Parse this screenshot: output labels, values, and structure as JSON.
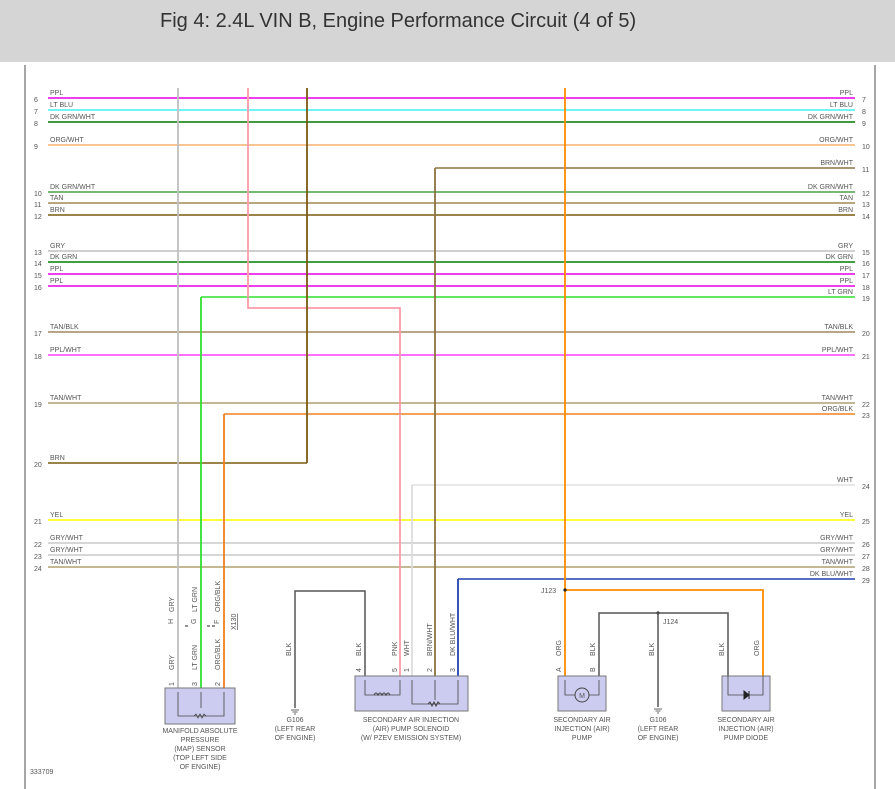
{
  "title": "Fig 4: 2.4L VIN B, Engine Performance Circuit (4 of 5)",
  "figure_id": "333709",
  "wires": [
    {
      "left_num": "6",
      "label": "PPL",
      "right_num": "7",
      "color": "#e600e6"
    },
    {
      "left_num": "7",
      "label": "LT BLU",
      "right_num": "8",
      "color": "#40f0f0"
    },
    {
      "left_num": "8",
      "label": "DK GRN/WHT",
      "right_num": "9",
      "color": "#007a00"
    },
    {
      "left_num": "9",
      "label": "ORG/WHT",
      "right_num": "10",
      "color": "#f5b070"
    },
    {
      "left_num": "",
      "label": "BRN/WHT",
      "right_num": "11",
      "color": "#8b7340"
    },
    {
      "left_num": "10",
      "label": "DK GRN/WHT",
      "right_num": "12",
      "color": "#4aa04a"
    },
    {
      "left_num": "11",
      "label": "TAN",
      "right_num": "13",
      "color": "#a08850"
    },
    {
      "left_num": "12",
      "label": "BRN",
      "right_num": "14",
      "color": "#7a5a10"
    },
    {
      "left_num": "13",
      "label": "GRY",
      "right_num": "15",
      "color": "#c0c0c0"
    },
    {
      "left_num": "14",
      "label": "DK GRN",
      "right_num": "16",
      "color": "#008000"
    },
    {
      "left_num": "15",
      "label": "PPL",
      "right_num": "17",
      "color": "#e600e6"
    },
    {
      "left_num": "16",
      "label": "PPL",
      "right_num": "18",
      "color": "#e600e6"
    },
    {
      "left_num": "",
      "label": "LT GRN",
      "right_num": "19",
      "color": "#30e030"
    },
    {
      "left_num": "17",
      "label": "TAN/BLK",
      "right_num": "20",
      "color": "#a08860"
    },
    {
      "left_num": "18",
      "label": "PPL/WHT",
      "right_num": "21",
      "color": "#ff40ff"
    },
    {
      "left_num": "19",
      "label": "TAN/WHT",
      "right_num": "22",
      "color": "#b0a070"
    },
    {
      "left_num": "",
      "label": "ORG/BLK",
      "right_num": "23",
      "color": "#f08020"
    },
    {
      "left_num": "20",
      "label": "BRN",
      "right_num": "",
      "color": "#7a5a10"
    },
    {
      "left_num": "",
      "label": "WHT",
      "right_num": "24",
      "color": "#e0e0e0"
    },
    {
      "left_num": "21",
      "label": "YEL",
      "right_num": "25",
      "color": "#ffff00"
    },
    {
      "left_num": "22",
      "label": "GRY/WHT",
      "right_num": "26",
      "color": "#c8c8c8"
    },
    {
      "left_num": "23",
      "label": "GRY/WHT",
      "right_num": "27",
      "color": "#c8c8c8"
    },
    {
      "left_num": "24",
      "label": "TAN/WHT",
      "right_num": "28",
      "color": "#b0a070"
    },
    {
      "left_num": "",
      "label": "DK BLU/WHT",
      "right_num": "29",
      "color": "#2040b0"
    }
  ],
  "colors": {
    "gry": "#c0c0c0",
    "pnk": "#ff9aaa",
    "brn": "#7a5a10",
    "org": "#ff8c00",
    "ltgrn": "#30e030",
    "orgblk": "#f08020",
    "wht": "#dddddd",
    "brnwht": "#8b7340",
    "dkbluwht": "#2040b0",
    "blk": "#555555",
    "component_fill": "#ccccf0"
  },
  "map_sensor": {
    "connector": "X130",
    "pins_top": [
      "H",
      "G",
      "F"
    ],
    "pins_bottom": [
      "1",
      "3",
      "2"
    ],
    "wire_labels": [
      "GRY",
      "LT GRN",
      "ORG/BLK"
    ],
    "name": [
      "MANIFOLD ABSOLUTE",
      "PRESSURE",
      "(MAP) SENSOR",
      "(TOP LEFT SIDE",
      "OF ENGINE)"
    ]
  },
  "ground1": {
    "wire": "BLK",
    "name": [
      "G106",
      "(LEFT REAR",
      "OF ENGINE)"
    ]
  },
  "solenoid": {
    "pins": [
      "4",
      "5",
      "1",
      "2",
      "3"
    ],
    "wire_labels": [
      "BLK",
      "PNK",
      "WHT",
      "BRN/WHT",
      "DK BLU/WHT"
    ],
    "name": [
      "SECONDARY AIR INJECTION",
      "(AIR) PUMP SOLENOID",
      "(W/ PZEV EMISSION SYSTEM)"
    ]
  },
  "splices": {
    "j123": "J123",
    "j124": "J124"
  },
  "pump": {
    "pins": [
      "A",
      "B"
    ],
    "wire_labels": [
      "ORG",
      "BLK"
    ],
    "motor": "M",
    "name": [
      "SECONDARY AIR",
      "INJECTION (AIR)",
      "PUMP"
    ]
  },
  "ground2": {
    "wire": "BLK",
    "name": [
      "G106",
      "(LEFT REAR",
      "OF ENGINE)"
    ]
  },
  "diode": {
    "wire_labels": [
      "BLK",
      "ORG"
    ],
    "name": [
      "SECONDARY AIR",
      "INJECTION (AIR)",
      "PUMP DIODE"
    ]
  }
}
